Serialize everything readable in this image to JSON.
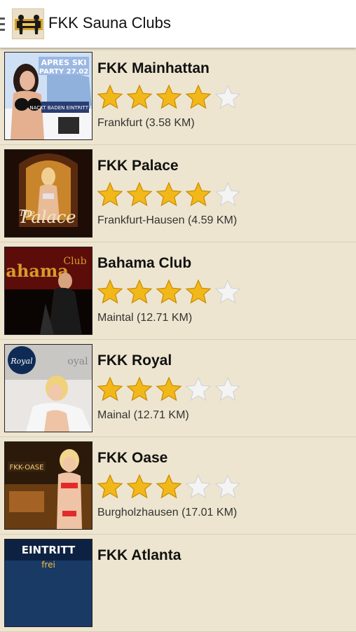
{
  "app_bar": {
    "title": "FKK Sauna Clubs"
  },
  "clubs": [
    {
      "name": "FKK Mainhattan",
      "location": "Frankfurt (3.58 KM)",
      "rating": 4,
      "max_rating": 5,
      "thumb_text": "APRES SKI PARTY 27.02"
    },
    {
      "name": "FKK Palace",
      "location": "Frankfurt-Hausen (4.59 KM)",
      "rating": 4,
      "max_rating": 5,
      "thumb_text": "The Palace"
    },
    {
      "name": "Bahama Club",
      "location": "Maintal (12.71 KM)",
      "rating": 4,
      "max_rating": 5,
      "thumb_text": "Bahama Club"
    },
    {
      "name": "FKK Royal",
      "location": "Mainal (12.71 KM)",
      "rating": 3,
      "max_rating": 5,
      "thumb_text": "Royal"
    },
    {
      "name": "FKK Oase",
      "location": "Burgholzhausen (17.01 KM)",
      "rating": 3,
      "max_rating": 5,
      "thumb_text": "FKK-OASE"
    },
    {
      "name": "FKK Atlanta",
      "location": "",
      "rating": null,
      "max_rating": 5,
      "thumb_text": "EINTRITT frei"
    }
  ],
  "colors": {
    "star_filled": "#f2b81a",
    "star_empty": "#f4f4f4",
    "background": "#ede5cf"
  }
}
